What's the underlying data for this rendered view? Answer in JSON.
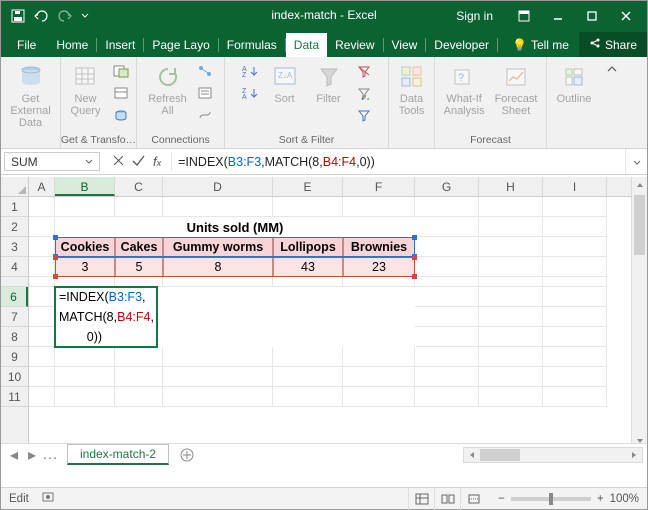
{
  "title": "index-match - Excel",
  "signin": "Sign in",
  "tabs": {
    "file": "File",
    "home": "Home",
    "insert": "Insert",
    "pagelayout": "Page Layo",
    "formulas": "Formulas",
    "data": "Data",
    "review": "Review",
    "view": "View",
    "developer": "Developer",
    "tellme": "Tell me",
    "share": "Share"
  },
  "ribbon": {
    "getdata": {
      "label": "Get External\nData"
    },
    "newquery": {
      "label": "New\nQuery"
    },
    "refresh": {
      "label": "Refresh\nAll"
    },
    "sort": {
      "label": "Sort"
    },
    "filter": {
      "label": "Filter"
    },
    "datatools": {
      "label": "Data\nTools"
    },
    "whatif": {
      "label": "What-If\nAnalysis"
    },
    "forecast": {
      "label": "Forecast\nSheet"
    },
    "outline": {
      "label": "Outline"
    },
    "groups": {
      "g1": "Get & Transfo…",
      "g2": "Connections",
      "g3": "Sort & Filter",
      "g4": "Forecast"
    }
  },
  "namebox": "SUM",
  "formula": {
    "pre": "=INDEX(",
    "a": "B3:F3",
    "mid": ",MATCH(8,",
    "b": "B4:F4",
    "post": ",0))"
  },
  "cols": [
    "A",
    "B",
    "C",
    "D",
    "E",
    "F",
    "G",
    "H",
    "I"
  ],
  "sheet": {
    "title": "Units sold (MM)",
    "headers": [
      "Cookies",
      "Cakes",
      "Gummy worms",
      "Lollipops",
      "Brownies"
    ],
    "values": [
      "3",
      "5",
      "8",
      "43",
      "23"
    ],
    "formula_lines": {
      "l1_pre": "=INDEX(",
      "l1_rng": "B3:F3",
      "l1_post": ",",
      "l2_pre": "MATCH(8,",
      "l2_rng": "B4:F4",
      "l2_post": ",",
      "l3": "        0))"
    }
  },
  "tabsheet": {
    "name": "index-match-2",
    "ellipsis": "…"
  },
  "status": {
    "mode": "Edit",
    "zoom": "100%"
  }
}
